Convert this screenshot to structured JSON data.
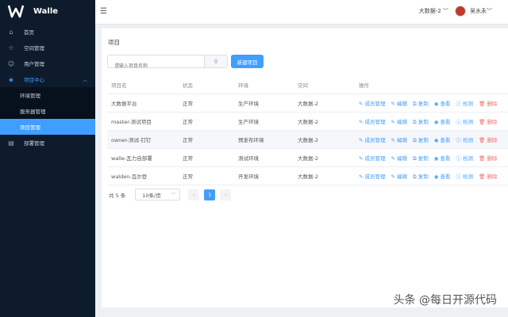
{
  "app": {
    "name": "Walle"
  },
  "sidebar": {
    "items": [
      {
        "label": "首页",
        "icon": "home-icon"
      },
      {
        "label": "空间管理",
        "icon": "star-icon"
      },
      {
        "label": "用户管理",
        "icon": "user-icon"
      },
      {
        "label": "项目中心",
        "icon": "layers-icon",
        "expanded": true
      },
      {
        "label": "部署管理",
        "icon": "document-icon"
      }
    ],
    "sub_items": [
      {
        "label": "环境管理"
      },
      {
        "label": "服务器管理"
      },
      {
        "label": "项目管理",
        "selected": true
      }
    ]
  },
  "header": {
    "space": "大数据-2",
    "user": "吴水永"
  },
  "main": {
    "title": "项目",
    "search_placeholder": "请输入项目名称",
    "new_button": "新建项目",
    "columns": [
      "项目名",
      "状态",
      "环境",
      "空间",
      "操作"
    ],
    "actions": [
      "成员管理",
      "编辑",
      "复制",
      "查看",
      "检测",
      "删除"
    ],
    "rows": [
      {
        "name": "大数据平台",
        "status": "正常",
        "env": "生产环境",
        "space": "大数据-2"
      },
      {
        "name": "master-测试项目",
        "status": "正常",
        "env": "生产环境",
        "space": "大数据-2"
      },
      {
        "name": "owner-测试-钉钉",
        "status": "正常",
        "env": "预发布环境",
        "space": "大数据-2"
      },
      {
        "name": "walle-瓦力自部署",
        "status": "正常",
        "env": "测试环境",
        "space": "大数据-2"
      },
      {
        "name": "walden-瓦尔登",
        "status": "正常",
        "env": "开发环境",
        "space": "大数据-2"
      }
    ],
    "pagination": {
      "total": "共 5 条",
      "page_size": "10条/页",
      "current_page": "1"
    }
  },
  "watermark": "头条 @每日开源代码",
  "colors": {
    "sidebar": "#0d1b2c",
    "accent": "#409eff",
    "danger": "#f56c6c"
  }
}
